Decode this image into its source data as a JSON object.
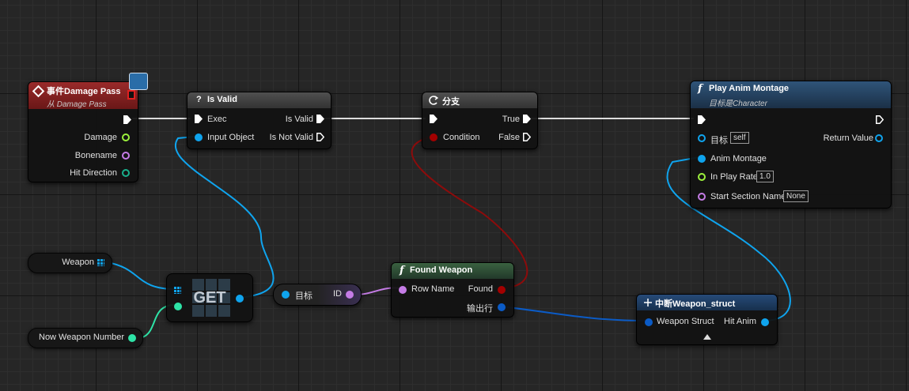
{
  "nodes": {
    "event": {
      "title": "事件Damage Pass",
      "subtitle": "从 Damage Pass",
      "pins": {
        "damage": "Damage",
        "bonename": "Bonename",
        "hit_direction": "Hit Direction"
      }
    },
    "is_valid": {
      "icon": "?",
      "title": "Is Valid",
      "pins": {
        "exec": "Exec",
        "input_object": "Input Object",
        "is_valid": "Is Valid",
        "is_not_valid": "Is Not Valid"
      }
    },
    "branch": {
      "title": "分支",
      "pins": {
        "condition": "Condition",
        "true": "True",
        "false": "False"
      }
    },
    "play_anim": {
      "title": "Play Anim Montage",
      "subtitle": "目标是Character",
      "pins": {
        "target": "目标",
        "target_value": "self",
        "return_value": "Return Value",
        "anim_montage": "Anim Montage",
        "in_play_rate": "In Play Rate",
        "in_play_rate_value": "1.0",
        "start_section_name": "Start Section Name",
        "start_section_value": "None"
      }
    },
    "weapon_var": {
      "label": "Weapon"
    },
    "now_weapon_var": {
      "label": "Now Weapon Number"
    },
    "get": {
      "label": "GET"
    },
    "id_getter": {
      "target": "目标",
      "id": "ID"
    },
    "found_weapon": {
      "title": "Found Weapon",
      "pins": {
        "row_name": "Row Name",
        "found": "Found",
        "out_row": "输出行"
      }
    },
    "break_struct": {
      "title": "中断Weapon_struct",
      "pins": {
        "weapon_struct": "Weapon Struct",
        "hit_anim": "Hit Anim"
      }
    }
  },
  "colors": {
    "exec": "#ffffff",
    "object": "#0fa4ee",
    "bool": "#a30000",
    "float": "#9cf13c",
    "name": "#c57ce6",
    "vector": "#19b08c",
    "int": "#2ee3a7",
    "struct": "#0b5bc6",
    "event_header": "#7c1d1d",
    "function_header": "#233e5c",
    "pure_header": "#29472f",
    "macro_header": "#3b3b3b"
  },
  "icons": [
    "diamond-event-icon",
    "bot-badge-icon",
    "question-icon",
    "branch-arrow-icon",
    "function-icon",
    "array-grid-icon",
    "expand-arrow-icon"
  ]
}
